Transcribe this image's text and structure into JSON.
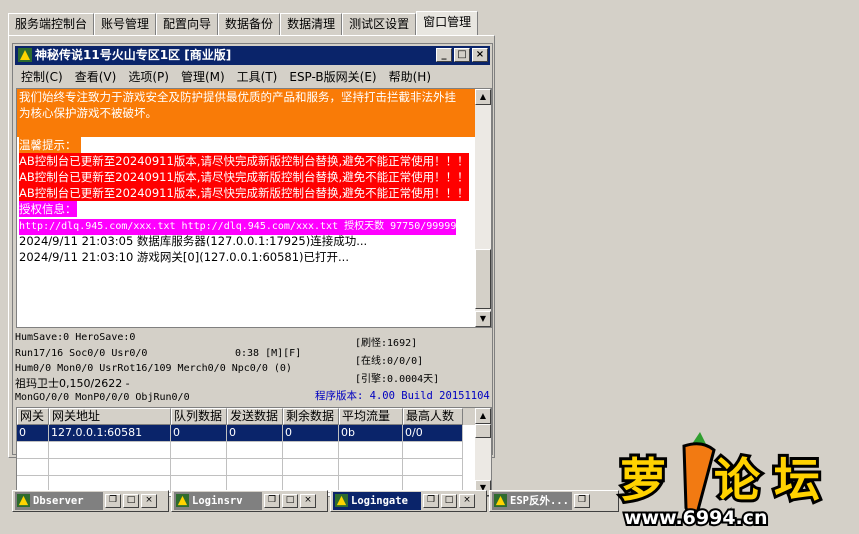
{
  "tabs": [
    "服务端控制台",
    "账号管理",
    "配置向导",
    "数据备份",
    "数据清理",
    "测试区设置",
    "窗口管理"
  ],
  "active_tab": "窗口管理",
  "window": {
    "title": "神秘传说11号火山专区1区 [商业版]",
    "menu": [
      "控制(C)",
      "查看(V)",
      "选项(P)",
      "管理(M)",
      "工具(T)",
      "ESP-B版网关(E)",
      "帮助(H)"
    ]
  },
  "log": {
    "lines": [
      {
        "style": "orange",
        "text": "我们始终专注致力于游戏安全及防护提供最优质的产品和服务，坚持打击拦截非法外挂"
      },
      {
        "style": "orange",
        "text": "为核心保护游戏不被破坏。"
      },
      {
        "style": "orange",
        "text": ""
      },
      {
        "style": "orange",
        "text": "温馨提示："
      },
      {
        "style": "red",
        "text": "AB控制台已更新至20240911版本,请尽快完成新版控制台替换,避免不能正常使用！！！"
      },
      {
        "style": "red",
        "text": "AB控制台已更新至20240911版本,请尽快完成新版控制台替换,避免不能正常使用！！！"
      },
      {
        "style": "red",
        "text": "AB控制台已更新至20240911版本,请尽快完成新版控制台替换,避免不能正常使用！！！"
      },
      {
        "style": "magenta",
        "text": "授权信息："
      },
      {
        "style": "magenta",
        "text": "http://dlq.945.com/xxx.txt http://dlq.945.com/xxx.txt 授权天数 97750/99999"
      },
      {
        "style": "plain",
        "text": "2024/9/11 21:03:05 数据库服务器(127.0.0.1:17925)连接成功..."
      },
      {
        "style": "plain",
        "text": "2024/9/11 21:03:10 游戏网关[0](127.0.0.1:60581)已打开..."
      }
    ]
  },
  "stats": {
    "save": "HumSave:0 HeroSave:0",
    "run": "Run17/16 Soc0/0 Usr0/0",
    "time": "0:38 [M][F]",
    "hum": "Hum0/0 Mon0/0 UsrRot16/109 Merch0/0 Npc0/0 (0)",
    "guard": "祖玛卫士0,150/2622 -",
    "mon": "MonGO/0/0 MonP0/0/0 ObjRun0/0",
    "refresh": "[刷怪:1692]",
    "online": "[在线:0/0/0]",
    "engine": "[引擎:0.0004天]",
    "version": "程序版本: 4.00 Build 20151104"
  },
  "table": {
    "columns": [
      "网关",
      "网关地址",
      "队列数据",
      "发送数据",
      "剩余数据",
      "平均流量",
      "最高人数"
    ],
    "rows": [
      [
        "0",
        "127.0.0.1:60581",
        "0",
        "0",
        "0",
        "0b",
        "0/0"
      ]
    ]
  },
  "minimized": [
    {
      "title": "Dbserver"
    },
    {
      "title": "Loginsrv"
    },
    {
      "title": "Logingate"
    },
    {
      "title": "ESP反外..."
    }
  ],
  "watermark": {
    "brand": "萝卜论坛",
    "url": "www.6994.cn"
  },
  "colors": {
    "title_bar": "#0a246a",
    "orange": "#f97b07",
    "red": "#ff0000",
    "magenta": "#ff00ff",
    "version_text": "#0000c0"
  }
}
